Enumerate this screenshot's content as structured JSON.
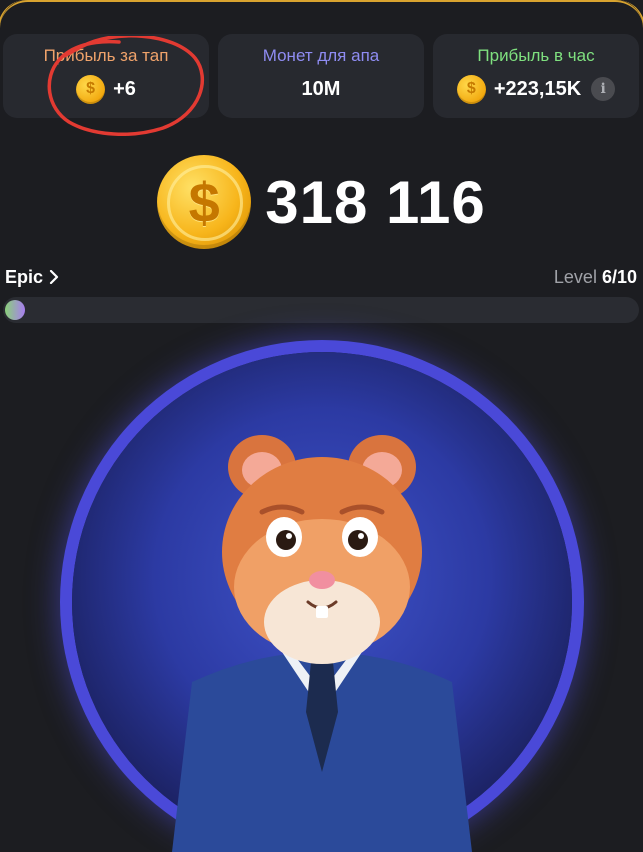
{
  "stats": [
    {
      "label": "Прибыль за тап",
      "value": "+6",
      "label_color": "#f0a36b",
      "coin_icon": "coin-icon"
    },
    {
      "label": "Монет для апа",
      "value": "10M",
      "label_color": "#8f8cf2"
    },
    {
      "label": "Прибыль в час",
      "value": "+223,15K",
      "label_color": "#7fe07f",
      "coin_icon": "coin-icon",
      "info_icon": "info-icon"
    }
  ],
  "balance": {
    "value": "318 116",
    "coin_icon": "big-coin-icon"
  },
  "league": {
    "label": "Epic",
    "chevron": "chevron-right-icon"
  },
  "level": {
    "prefix": "Level",
    "value": "6/10",
    "progress_fraction": 0.02
  },
  "colors": {
    "accent_frame": "#d8a32f",
    "annotation_red": "#e23a32",
    "tap_ring": "#4a49d8"
  },
  "mascot": "hamster-ceo"
}
